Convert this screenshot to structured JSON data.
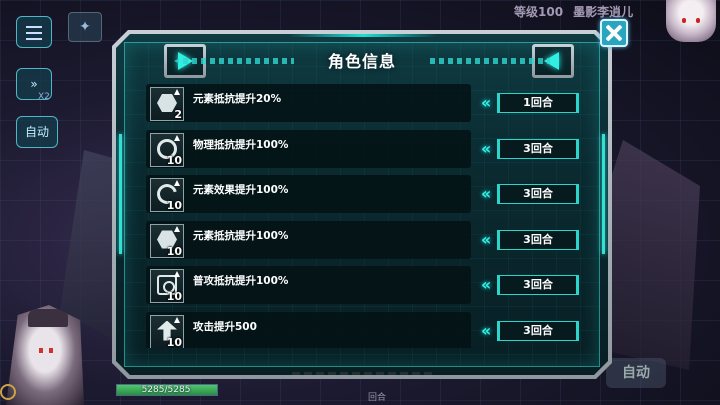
{
  "hud": {
    "level": "等级100",
    "player_name": "墨影李逍儿",
    "speed_multiplier": "X2",
    "auto_label": "自动",
    "hp_text": "5285/5285",
    "hp_fraction": 1.0,
    "bottom_right_button": "自动",
    "bottom_turn_label": "回合"
  },
  "panel": {
    "title": "角色信息",
    "accent_color": "#2ff0e2",
    "effects": [
      {
        "icon": "hex-shield-icon",
        "name": "元素抵抗提升20%",
        "stack": "2",
        "duration": "1回合"
      },
      {
        "icon": "ring-shield-icon",
        "name": "物理抵抗提升100%",
        "stack": "10",
        "duration": "3回合"
      },
      {
        "icon": "swirl-element-icon",
        "name": "元素效果提升100%",
        "stack": "10",
        "duration": "3回合"
      },
      {
        "icon": "hex-shield-icon",
        "name": "元素抵抗提升100%",
        "stack": "10",
        "duration": "3回合"
      },
      {
        "icon": "target-icon",
        "name": "普攻抵抗提升100%",
        "stack": "10",
        "duration": "3回合"
      },
      {
        "icon": "attack-up-icon",
        "name": "攻击提升500",
        "stack": "10",
        "duration": "3回合"
      }
    ]
  }
}
